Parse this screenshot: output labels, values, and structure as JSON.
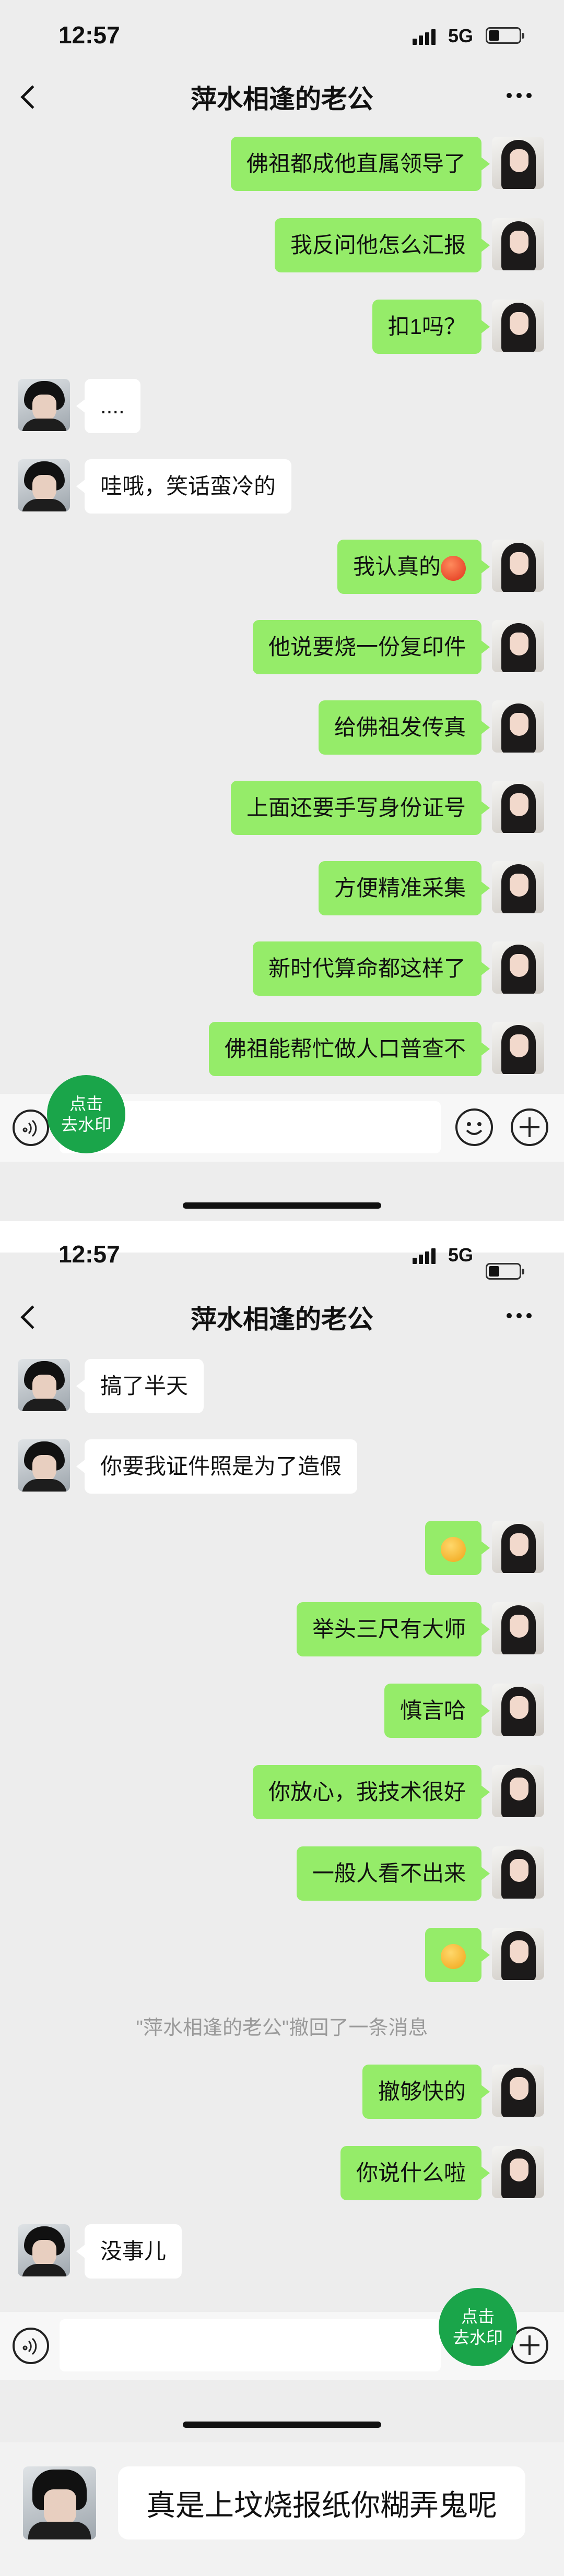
{
  "status": {
    "time": "12:57",
    "network": "5G"
  },
  "nav": {
    "title": "萍水相逢的老公"
  },
  "watermark_button": {
    "line1": "点击",
    "line2": "去水印"
  },
  "screen1": {
    "messages": [
      {
        "from": "me",
        "text": "佛祖都成他直属领导了"
      },
      {
        "from": "me",
        "text": "我反问他怎么汇报"
      },
      {
        "from": "me",
        "text": "扣1吗？"
      },
      {
        "from": "other",
        "text": "...."
      },
      {
        "from": "other",
        "text": "哇哦，笑话蛮冷的"
      },
      {
        "from": "me",
        "text": "我认真的",
        "emoji": "angry-face-icon"
      },
      {
        "from": "me",
        "text": "他说要烧一份复印件"
      },
      {
        "from": "me",
        "text": "给佛祖发传真"
      },
      {
        "from": "me",
        "text": "上面还要手写身份证号"
      },
      {
        "from": "me",
        "text": "方便精准采集"
      },
      {
        "from": "me",
        "text": "新时代算命都这样了"
      },
      {
        "from": "me",
        "text": "佛祖能帮忙做人口普查不"
      }
    ]
  },
  "screen2": {
    "messages": [
      {
        "from": "other",
        "text": "搞了半天"
      },
      {
        "from": "other",
        "text": "你要我证件照是为了造假"
      },
      {
        "from": "me",
        "text": "",
        "emoji": "cold-sweat-face-icon"
      },
      {
        "from": "me",
        "text": "举头三尺有大师"
      },
      {
        "from": "me",
        "text": "慎言哈"
      },
      {
        "from": "me",
        "text": "你放心，我技术很好"
      },
      {
        "from": "me",
        "text": "一般人看不出来"
      },
      {
        "from": "me",
        "text": "",
        "emoji": "thinking-face-icon"
      }
    ],
    "system_message": "\"萍水相逢的老公\"撤回了一条消息",
    "messages_after": [
      {
        "from": "me",
        "text": "撤够快的"
      },
      {
        "from": "me",
        "text": "你说什么啦"
      },
      {
        "from": "other",
        "text": "没事儿"
      }
    ]
  },
  "bottom_card": {
    "text": "真是上坟烧报纸你糊弄鬼呢"
  }
}
